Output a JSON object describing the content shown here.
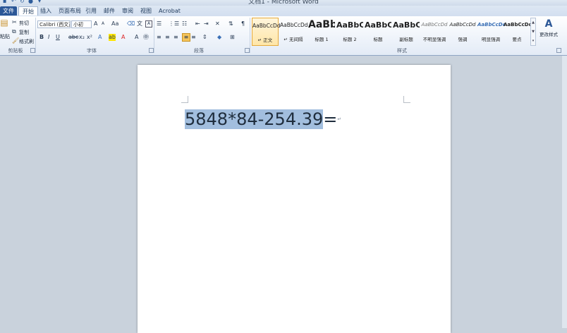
{
  "window": {
    "title": "文档1 - Microsoft Word"
  },
  "tabs": [
    "文件",
    "开始",
    "插入",
    "页面布局",
    "引用",
    "邮件",
    "审阅",
    "视图",
    "Acrobat"
  ],
  "clipboard": {
    "paste_label": "粘贴",
    "cut_label": "剪切",
    "copy_label": "复制",
    "format_painter_label": "格式刷",
    "group_label": "剪贴板"
  },
  "font": {
    "name": "Calibri (西文正",
    "size": "小初",
    "group_label": "字体"
  },
  "paragraph": {
    "group_label": "段落"
  },
  "styles": {
    "group_label": "样式",
    "items": [
      {
        "preview": "AaBbCcDd",
        "name": "↵ 正文"
      },
      {
        "preview": "AaBbCcDd",
        "name": "↵ 无间隔"
      },
      {
        "preview": "AaBb",
        "name": "标题 1"
      },
      {
        "preview": "AaBbC",
        "name": "标题 2"
      },
      {
        "preview": "AaBbC",
        "name": "标题"
      },
      {
        "preview": "AaBbC",
        "name": "副标题"
      },
      {
        "preview": "AaBbCcDd",
        "name": "不明显强调"
      },
      {
        "preview": "AaBbCcDd",
        "name": "强调"
      },
      {
        "preview": "AaBbCcDc",
        "name": "明显强调"
      },
      {
        "preview": "AaBbCcDc",
        "name": "要点"
      }
    ],
    "change_styles_label": "更改样式"
  },
  "document": {
    "selected_text": "5848*84-254.39",
    "after_text": "=",
    "paragraph_mark": "↵"
  },
  "colors": {
    "accent": "#2b5797",
    "selection": "#a2bede",
    "highlight": "#e6a93b"
  }
}
